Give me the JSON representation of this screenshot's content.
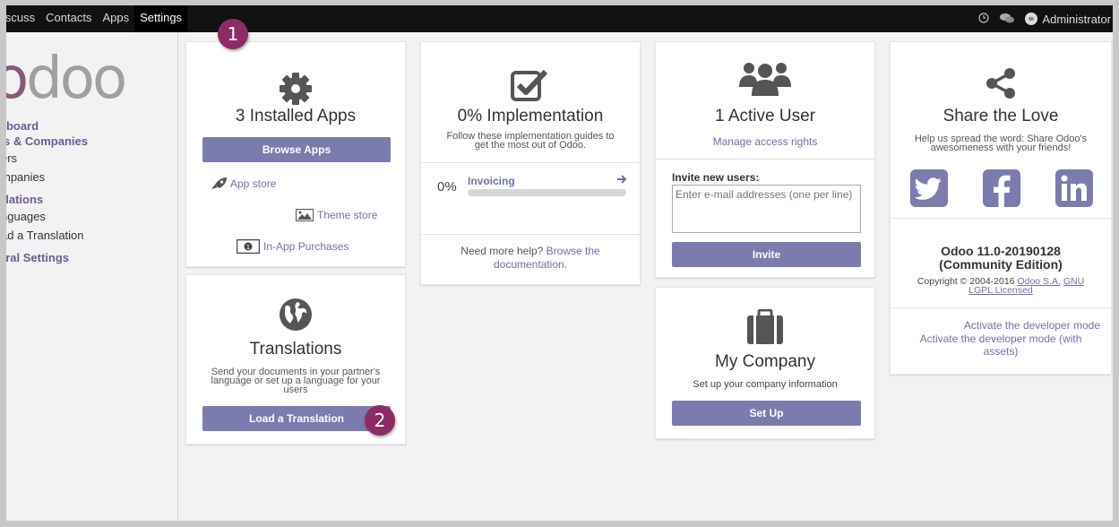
{
  "topbar": {
    "menu": [
      "iscuss",
      "Contacts",
      "Apps",
      "Settings"
    ],
    "active": "Settings",
    "user": "Administrator"
  },
  "sidebar": {
    "logo": "odoo",
    "items": [
      {
        "label": "hboard",
        "type": "section"
      },
      {
        "label": "rs & Companies",
        "type": "section"
      },
      {
        "label": "ers",
        "type": "item"
      },
      {
        "label": "mpanies",
        "type": "item"
      },
      {
        "label": "slations",
        "type": "section"
      },
      {
        "label": "nguages",
        "type": "item"
      },
      {
        "label": "ad a Translation",
        "type": "item"
      },
      {
        "label": "eral Settings",
        "type": "section"
      }
    ]
  },
  "apps_card": {
    "title": "3 Installed Apps",
    "button": "Browse Apps",
    "app_store": "App store",
    "theme_store": "Theme store",
    "in_app": "In-App Purchases"
  },
  "impl_card": {
    "title": "0% Implementation",
    "subtitle_1": "Follow these implementation guides to",
    "subtitle_2": "get the most out of Odoo.",
    "percent": "0%",
    "guide": "Invoicing",
    "guide_progress": 0,
    "help_text": "Need more help? ",
    "help_link_1": "Browse the",
    "help_link_2": "documentation."
  },
  "users_card": {
    "title": "1 Active User",
    "manage": "Manage access rights",
    "invite_label": "Invite new users:",
    "invite_placeholder": "Enter e-mail addresses (one per line)",
    "button": "Invite"
  },
  "share_card": {
    "title": "Share the Love",
    "subtitle_1": "Help us spread the word: Share Odoo's",
    "subtitle_2": "awesomeness with your friends!",
    "version_1": "Odoo 11.0-20190128",
    "version_2": "(Community Edition)",
    "copyright": "Copyright © 2004-2016 ",
    "odoo_sa": "Odoo S.A.",
    "gnu": "GNU",
    "lgpl": "LGPL Licensed",
    "dev_mode": "Activate the developer mode",
    "dev_mode_assets_1": "Activate the developer mode (with",
    "dev_mode_assets_2": "assets)"
  },
  "translations_card": {
    "title": "Translations",
    "subtitle_1": "Send your documents in your partner's",
    "subtitle_2": "language or set up a language for your",
    "subtitle_3": "users",
    "button": "Load a Translation"
  },
  "company_card": {
    "title": "My Company",
    "subtitle": "Set up your company information",
    "button": "Set Up"
  },
  "badges": {
    "one": "1",
    "two": "2"
  },
  "colors": {
    "accent": "#7c7bad",
    "brand": "#875a7b",
    "badge": "#8b2c66"
  }
}
